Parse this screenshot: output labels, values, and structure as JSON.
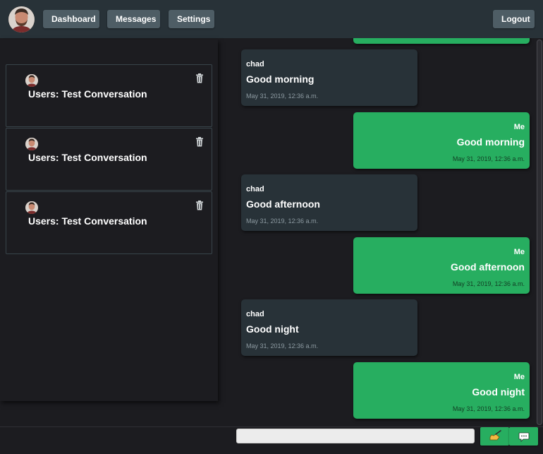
{
  "nav": {
    "dashboard": "Dashboard",
    "messages": "Messages",
    "settings": "Settings",
    "logout": "Logout"
  },
  "conversations": [
    {
      "title": "Users: Test Conversation"
    },
    {
      "title": "Users: Test Conversation"
    },
    {
      "title": "Users: Test Conversation"
    }
  ],
  "messages": [
    {
      "from": "chad",
      "text": "Good morning",
      "time": "May 31, 2019, 12:36 a.m."
    },
    {
      "from": "Me",
      "text": "Good morning",
      "time": "May 31, 2019, 12:36 a.m."
    },
    {
      "from": "chad",
      "text": "Good afternoon",
      "time": "May 31, 2019, 12:36 a.m."
    },
    {
      "from": "Me",
      "text": "Good afternoon",
      "time": "May 31, 2019, 12:36 a.m."
    },
    {
      "from": "chad",
      "text": "Good night",
      "time": "May 31, 2019, 12:36 a.m."
    },
    {
      "from": "Me",
      "text": "Good night",
      "time": "May 31, 2019, 12:36 a.m."
    }
  ],
  "composer": {
    "input_value": "",
    "sign_icon": "writing-hand-icon",
    "send_icon": "chat-bubble-icon"
  },
  "colors": {
    "topbar": "#283238",
    "background": "#1c1c20",
    "accent": "#27ae60",
    "incoming_bubble": "#283238",
    "nav_button": "#4e5d65"
  }
}
